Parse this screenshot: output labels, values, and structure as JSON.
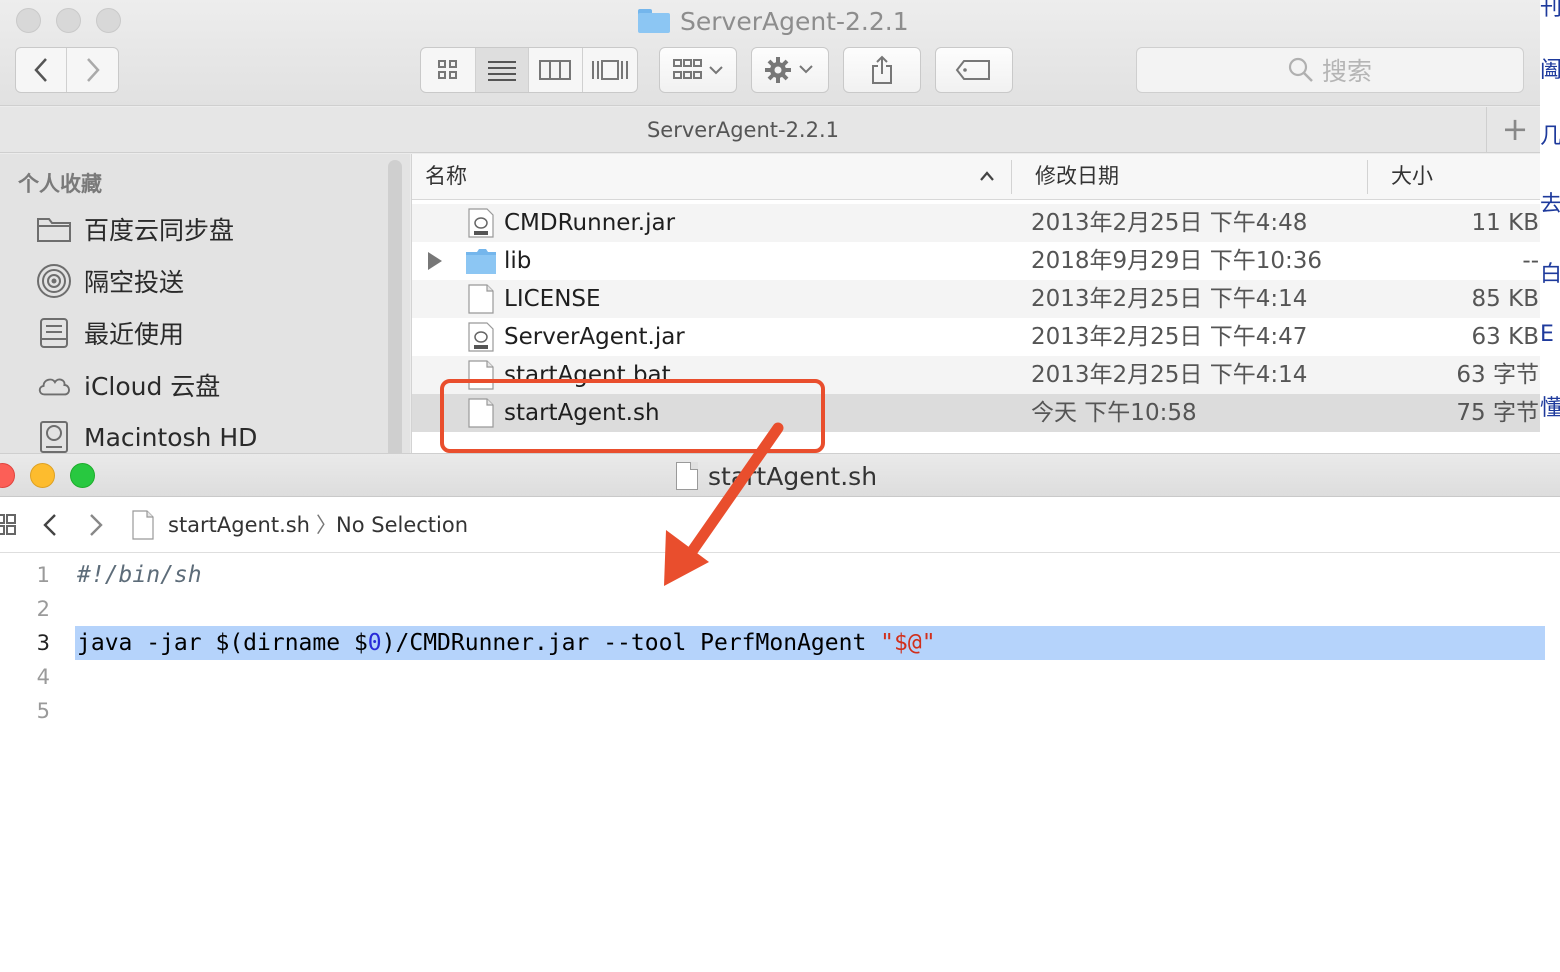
{
  "finder": {
    "window_title": "ServerAgent-2.2.1",
    "path_tab_label": "ServerAgent-2.2.1",
    "search_placeholder": "搜索",
    "sidebar": {
      "heading": "个人收藏",
      "items": [
        {
          "label": "百度云同步盘",
          "icon": "folder-icon"
        },
        {
          "label": "隔空投送",
          "icon": "airdrop-icon"
        },
        {
          "label": "最近使用",
          "icon": "recents-icon"
        },
        {
          "label": "iCloud 云盘",
          "icon": "cloud-icon"
        },
        {
          "label": "Macintosh HD",
          "icon": "disk-icon"
        }
      ]
    },
    "columns": {
      "name": "名称",
      "date": "修改日期",
      "size": "大小"
    },
    "files": [
      {
        "name": "CMDRunner.jar",
        "date": "2013年2月25日 下午4:48",
        "size": "11 KB",
        "icon": "jar-icon"
      },
      {
        "name": "lib",
        "date": "2018年9月29日 下午10:36",
        "size": "--",
        "icon": "folder-icon"
      },
      {
        "name": "LICENSE",
        "date": "2013年2月25日 下午4:14",
        "size": "85 KB",
        "icon": "document-icon"
      },
      {
        "name": "ServerAgent.jar",
        "date": "2013年2月25日 下午4:47",
        "size": "63 KB",
        "icon": "jar-icon"
      },
      {
        "name": "startAgent.bat",
        "date": "2013年2月25日 下午4:14",
        "size": "63 字节",
        "icon": "document-icon"
      },
      {
        "name": "startAgent.sh",
        "date": "今天 下午10:58",
        "size": "75 字节",
        "icon": "document-icon"
      }
    ],
    "right_edge_chars": [
      "刊",
      "阖",
      "几",
      "去",
      "白",
      "E",
      "懂"
    ]
  },
  "editor": {
    "window_title": "startAgent.sh",
    "jumpbar": {
      "file": "startAgent.sh",
      "separator": "〉",
      "selection": "No Selection"
    },
    "lines": [
      {
        "number": "1",
        "text": "#!/bin/sh"
      },
      {
        "number": "2",
        "text": ""
      },
      {
        "number": "3",
        "prefix": "java -jar $(dirname $",
        "num": "0",
        "mid": ")/CMDRunner.jar --tool PerfMonAgent ",
        "str": "\"$@\""
      },
      {
        "number": "4",
        "text": ""
      },
      {
        "number": "5",
        "text": ""
      }
    ],
    "current_line": 3
  },
  "colors": {
    "annotation": "#e94e2d",
    "selection": "#b5d3fb",
    "close": "#fc5f57",
    "minimize": "#fdbc2e",
    "zoom": "#28c840"
  }
}
